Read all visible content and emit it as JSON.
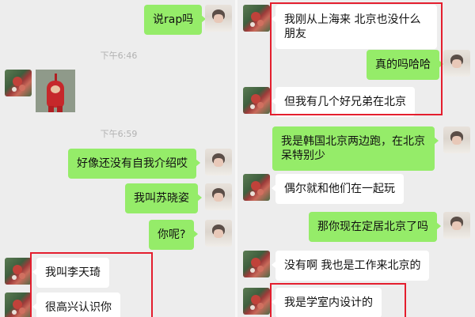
{
  "left_chat": {
    "messages": [
      {
        "side": "right",
        "text": "说rap吗"
      },
      {
        "type": "time",
        "text": "下午6:46"
      },
      {
        "side": "left",
        "type": "sticker",
        "sticker_icon": "teletubby-sticker"
      },
      {
        "type": "time",
        "text": "下午6:59"
      },
      {
        "side": "right",
        "text": "好像还没有自我介绍哎"
      },
      {
        "side": "right",
        "text": "我叫苏晓姿"
      },
      {
        "side": "right",
        "text": "你呢?"
      },
      {
        "side": "left",
        "text": "我叫李天琦"
      },
      {
        "side": "left",
        "text": "很高兴认识你"
      }
    ]
  },
  "right_chat": {
    "messages": [
      {
        "side": "left",
        "text": "我刚从上海来 北京也没什么朋友"
      },
      {
        "side": "right",
        "text": "真的吗哈哈"
      },
      {
        "side": "left",
        "text": "但我有几个好兄弟在北京"
      },
      {
        "side": "right",
        "text": "我是韩国北京两边跑，在北京呆特别少"
      },
      {
        "side": "left",
        "text": "偶尔就和他们在一起玩"
      },
      {
        "side": "right",
        "text": "那你现在定居北京了吗"
      },
      {
        "side": "left",
        "text": "没有啊 我也是工作来北京的"
      },
      {
        "side": "left",
        "text": "我是学室内设计的"
      }
    ]
  },
  "colors": {
    "background": "#ededed",
    "sent_bubble": "#95ec69",
    "received_bubble": "#ffffff",
    "highlight_box": "#e41e2e",
    "timestamp": "#b2b2b2"
  },
  "avatars": {
    "self": "person-avatar",
    "other": "flower-avatar"
  }
}
